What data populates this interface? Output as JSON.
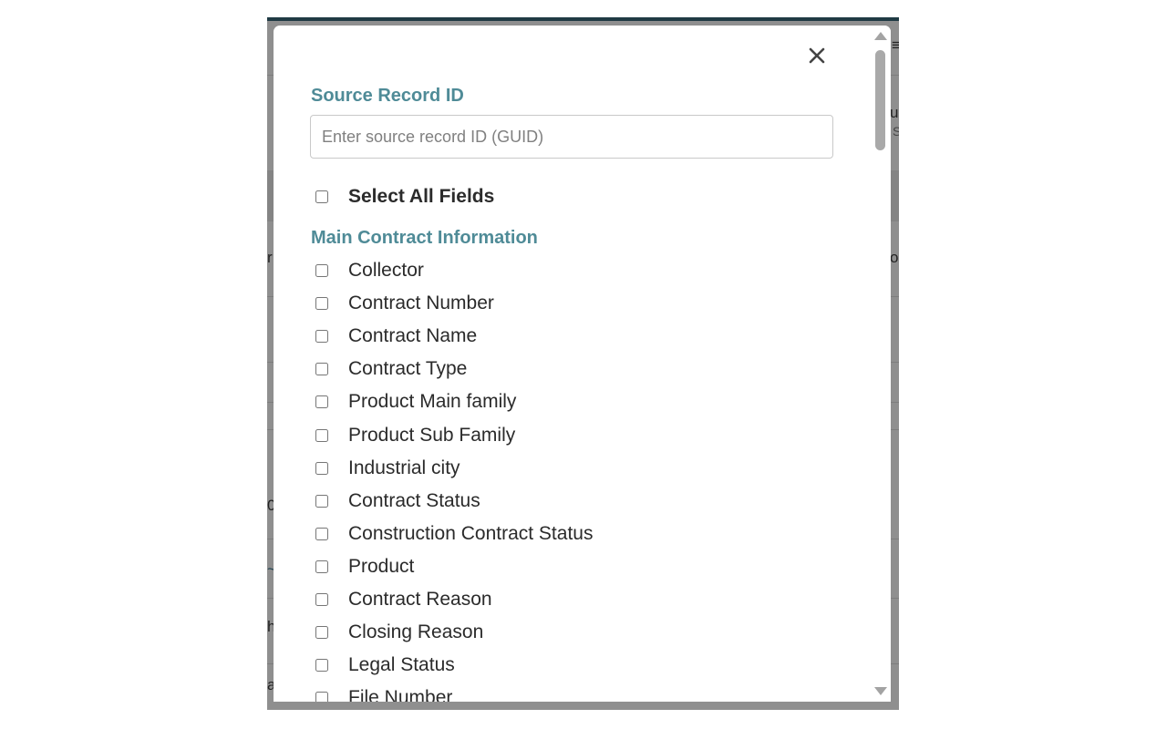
{
  "modal": {
    "close_glyph": "✕",
    "source_record": {
      "heading": "Source Record ID",
      "placeholder": "Enter source record ID (GUID)",
      "value": ""
    },
    "select_all_label": "Select All Fields",
    "section_heading": "Main Contract Information",
    "fields": [
      {
        "label": "Collector",
        "checked": false
      },
      {
        "label": "Contract Number",
        "checked": false
      },
      {
        "label": "Contract Name",
        "checked": false
      },
      {
        "label": "Contract Type",
        "checked": false
      },
      {
        "label": "Product Main family",
        "checked": false
      },
      {
        "label": "Product Sub Family",
        "checked": false
      },
      {
        "label": "Industrial city",
        "checked": false
      },
      {
        "label": "Contract Status",
        "checked": false
      },
      {
        "label": "Construction Contract Status",
        "checked": false
      },
      {
        "label": "Product",
        "checked": false
      },
      {
        "label": "Contract Reason",
        "checked": false
      },
      {
        "label": "Closing Reason",
        "checked": false
      },
      {
        "label": "Legal Status",
        "checked": false
      },
      {
        "label": "File Number",
        "checked": false
      }
    ]
  },
  "colors": {
    "heading": "#4f8b97",
    "overlay": "#8f8f8f",
    "topbar": "#1f3a44"
  }
}
